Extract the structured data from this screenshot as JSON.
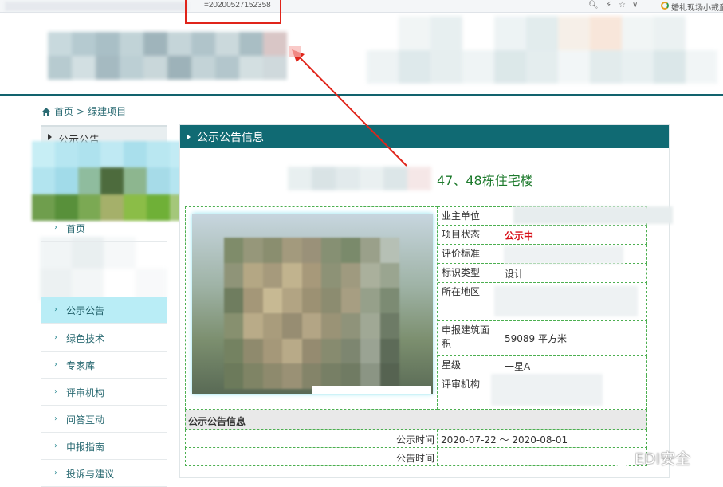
{
  "browser": {
    "url_fragment": "=20200527152358",
    "extension_text": "婚礼现场小戒童"
  },
  "breadcrumb": {
    "home": "首页",
    "separator": ">",
    "current": "绿建项目"
  },
  "sidebar": {
    "header": "公示公告",
    "items": [
      {
        "label": "首页",
        "active": false
      },
      {
        "label": "公示公告",
        "active": true
      },
      {
        "label": "绿色技术",
        "active": false
      },
      {
        "label": "专家库",
        "active": false
      },
      {
        "label": "评审机构",
        "active": false
      },
      {
        "label": "问答互动",
        "active": false
      },
      {
        "label": "申报指南",
        "active": false
      },
      {
        "label": "投诉与建议",
        "active": false
      }
    ]
  },
  "panel": {
    "header": "公示公告信息",
    "project_title": "47、48栋住宅楼",
    "fields": [
      {
        "key": "业主单位",
        "value": ""
      },
      {
        "key": "项目状态",
        "value": "公示中"
      },
      {
        "key": "评价标准",
        "value": ""
      },
      {
        "key": "标识类型",
        "value": "设计"
      },
      {
        "key": "所在地区",
        "value": ""
      },
      {
        "key": "申报建筑面积",
        "value": "59089 平方米"
      },
      {
        "key": "星级",
        "value": "一星A"
      },
      {
        "key": "评审机构",
        "value": ""
      }
    ],
    "section_title": "公示公告信息",
    "notice_rows": [
      {
        "key": "公示时间",
        "value": "2020-07-22 ～ 2020-08-01"
      },
      {
        "key": "公告时间",
        "value": ""
      }
    ]
  },
  "watermark": {
    "text": "EDI安全"
  },
  "colors": {
    "teal": "#106a73",
    "highlight": "#e0241a",
    "status_red": "#d8121b",
    "title_green": "#1d7a2c"
  }
}
